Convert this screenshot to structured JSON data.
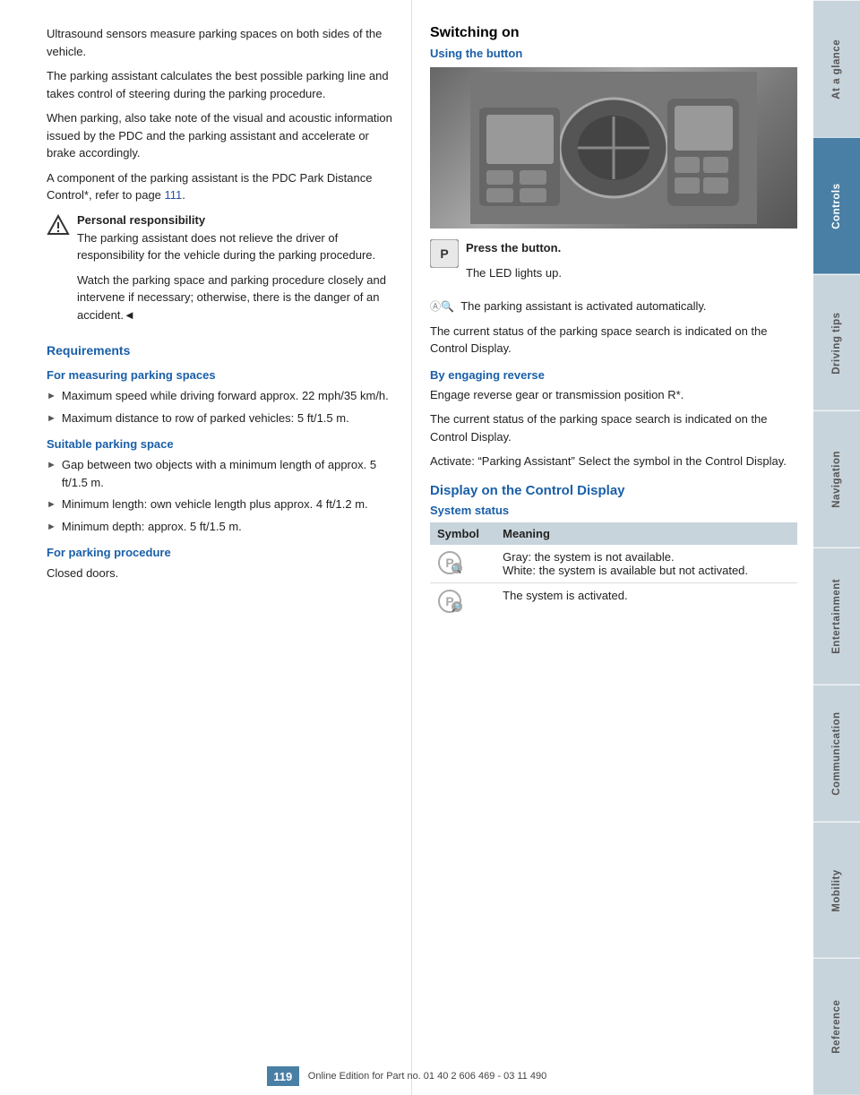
{
  "sidebar": {
    "tabs": [
      {
        "id": "at-a-glance",
        "label": "At a glance",
        "active": false
      },
      {
        "id": "controls",
        "label": "Controls",
        "active": true
      },
      {
        "id": "driving-tips",
        "label": "Driving tips",
        "active": false
      },
      {
        "id": "navigation",
        "label": "Navigation",
        "active": false
      },
      {
        "id": "entertainment",
        "label": "Entertainment",
        "active": false
      },
      {
        "id": "communication",
        "label": "Communication",
        "active": false
      },
      {
        "id": "mobility",
        "label": "Mobility",
        "active": false
      },
      {
        "id": "reference",
        "label": "Reference",
        "active": false
      }
    ]
  },
  "left": {
    "intro_paragraphs": [
      "Ultrasound sensors measure parking spaces on both sides of the vehicle.",
      "The parking assistant calculates the best possible parking line and takes control of steering during the parking procedure.",
      "When parking, also take note of the visual and acoustic information issued by the PDC and the parking assistant and accelerate or brake accordingly.",
      "A component of the parking assistant is the PDC Park Distance Control*, refer to page 111."
    ],
    "page_ref": "111",
    "warning": {
      "title": "Personal responsibility",
      "text": "The parking assistant does not relieve the driver of responsibility for the vehicle during the parking procedure.",
      "extra": "Watch the parking space and parking procedure closely and intervene if necessary; otherwise, there is the danger of an accident.◄"
    },
    "requirements_heading": "Requirements",
    "for_measuring_heading": "For measuring parking spaces",
    "measuring_bullets": [
      "Maximum speed while driving forward approx. 22 mph/35 km/h.",
      "Maximum distance to row of parked vehicles: 5 ft/1.5 m."
    ],
    "suitable_heading": "Suitable parking space",
    "suitable_bullets": [
      "Gap between two objects with a minimum length of approx. 5 ft/1.5 m.",
      "Minimum length: own vehicle length plus approx. 4 ft/1.2 m.",
      "Minimum depth: approx. 5 ft/1.5 m."
    ],
    "for_parking_heading": "For parking procedure",
    "for_parking_text": "Closed doors."
  },
  "right": {
    "switching_heading": "Switching on",
    "using_button_heading": "Using the button",
    "press_text": "Press the button.",
    "led_text": "The LED lights up.",
    "activated_text": "The parking assistant is activated automatically.",
    "status_text": "The current status of the parking space search is indicated on the Control Display.",
    "engaging_heading": "By engaging reverse",
    "engage_p1": "Engage reverse gear or transmission position R*.",
    "engage_p2": "The current status of the parking space search is indicated on the Control Display.",
    "engage_p3": "Activate: “Parking Assistant” Select the symbol in the Control Display.",
    "display_heading": "Display on the Control Display",
    "system_status_heading": "System status",
    "table": {
      "headers": [
        "Symbol",
        "Meaning"
      ],
      "rows": [
        {
          "symbol_type": "gray",
          "meaning": "Gray: the system is not available.\nWhite: the system is available but not activated."
        },
        {
          "symbol_type": "active",
          "meaning": "The system is activated."
        }
      ]
    }
  },
  "footer": {
    "page_number": "119",
    "edition_text": "Online Edition for Part no. 01 40 2 606 469 - 03 11 490"
  }
}
